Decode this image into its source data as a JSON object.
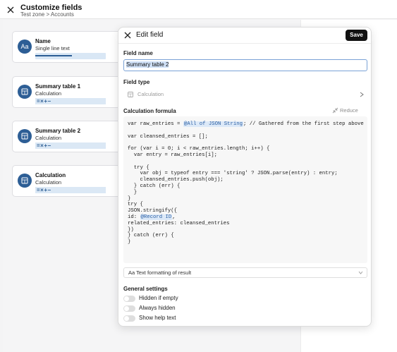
{
  "header": {
    "title": "Customize fields",
    "breadcrumb": "Test zone > Accounts"
  },
  "fields": [
    {
      "name": "Name",
      "type": "Single line text",
      "icon": "Aa"
    },
    {
      "name": "Summary table 1",
      "type": "Calculation",
      "ops": "=×+−"
    },
    {
      "name": "Summary table 2",
      "type": "Calculation",
      "ops": "=×+−"
    },
    {
      "name": "Calculation",
      "type": "Calculation",
      "ops": "=×+−"
    }
  ],
  "modal": {
    "title": "Edit field",
    "save_label": "Save",
    "field_name_label": "Field name",
    "field_name_value": "Summary table 2",
    "field_type_label": "Field type",
    "field_type_value": "Calculation",
    "formula_label": "Calculation formula",
    "reduce_label": "Reduce",
    "formula_token_all": "@All of JSON String",
    "formula_token_record": "@Record ID",
    "formula_lines": {
      "l1_pre": "var raw_entries = ",
      "l1_post": "; // Gathered from the first step above",
      "l2": "var cleansed_entries = [];",
      "l3": "for (var i = 0; i < raw_entries.length; i++) {",
      "l4": "  var entry = raw_entries[i];",
      "l5": "  try {",
      "l6": "    var obj = typeof entry === 'string' ? JSON.parse(entry) : entry;",
      "l7": "    cleansed_entries.push(obj);",
      "l8": "  } catch (err) {",
      "l9": "  }",
      "l10": "}",
      "l11": "try {",
      "l12": "JSON.stringify({",
      "l13_pre": "id: ",
      "l13_post": ",",
      "l14": "related_entries: cleansed_entries",
      "l15": "})",
      "l16": "} catch (err) {",
      "l17": "}"
    },
    "text_formatting_label": "Aa Text formatting of result",
    "general_settings_label": "General settings",
    "toggles": [
      {
        "label": "Hidden if empty",
        "on": false
      },
      {
        "label": "Always hidden",
        "on": false
      },
      {
        "label": "Show help text",
        "on": false
      }
    ]
  },
  "colors": {
    "accent": "#2d5e95",
    "token_bg": "#dce9f8",
    "save_bg": "#111111"
  }
}
